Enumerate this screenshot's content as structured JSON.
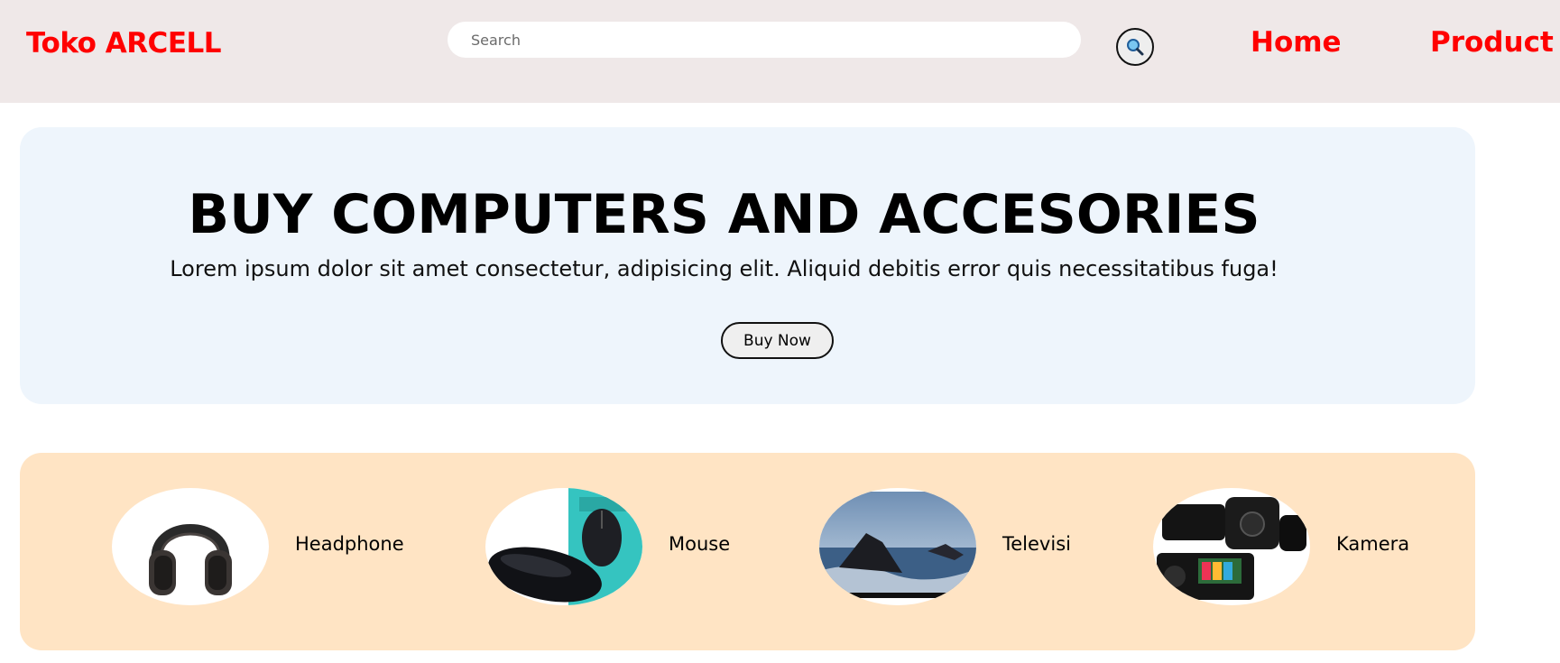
{
  "header": {
    "brand": "Toko ARCELL",
    "search": {
      "placeholder": "Search",
      "value": ""
    },
    "nav": [
      "Home",
      "Product"
    ]
  },
  "hero": {
    "title": "BUY COMPUTERS AND ACCESORIES",
    "text": "Lorem ipsum dolor sit amet consectetur, adipisicing elit. Aliquid debitis error quis necessitatibus fuga!",
    "button": "Buy Now"
  },
  "categories": [
    {
      "label": "Headphone",
      "icon": "headphone-image"
    },
    {
      "label": "Mouse",
      "icon": "mouse-image"
    },
    {
      "label": "Televisi",
      "icon": "television-image"
    },
    {
      "label": "Kamera",
      "icon": "camera-image"
    }
  ],
  "colors": {
    "brand_red": "#ff0000",
    "header_bg": "#efe8e8",
    "hero_bg": "#eef5fc",
    "categories_bg": "#ffe4c4"
  }
}
